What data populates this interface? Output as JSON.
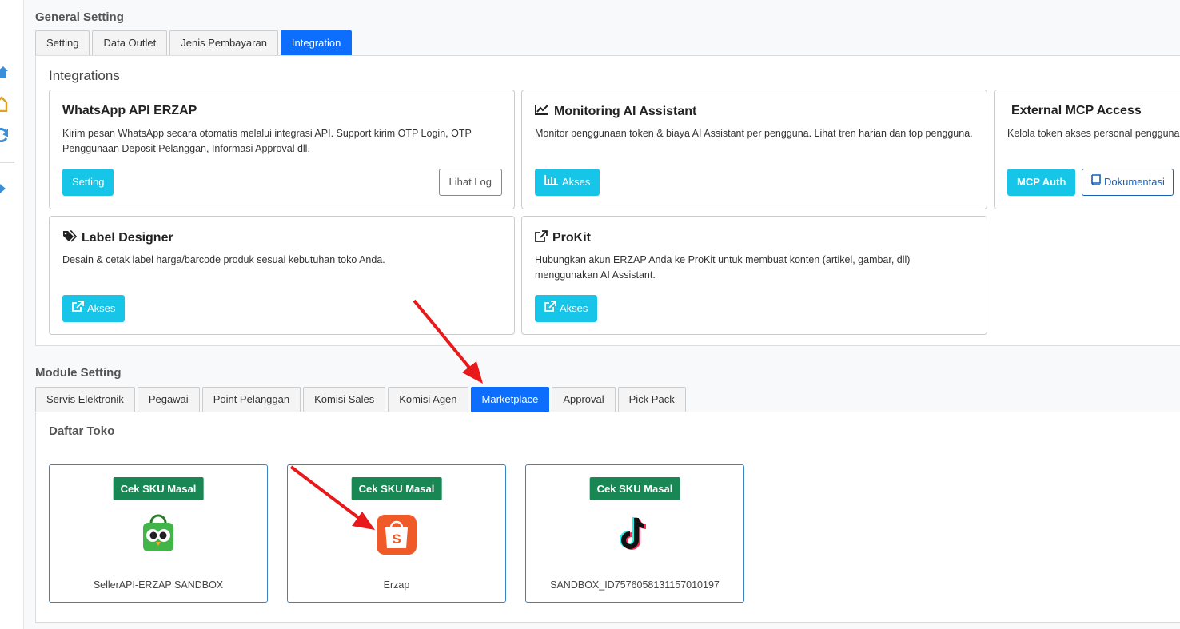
{
  "general": {
    "title": "General Setting",
    "tabs": [
      {
        "label": "Setting",
        "active": false
      },
      {
        "label": "Data Outlet",
        "active": false
      },
      {
        "label": "Jenis Pembayaran",
        "active": false
      },
      {
        "label": "Integration",
        "active": true
      }
    ]
  },
  "integrations": {
    "heading": "Integrations",
    "cards": [
      {
        "title": "WhatsApp API ERZAP",
        "desc": "Kirim pesan WhatsApp secara otomatis melalui integrasi API. Support kirim OTP Login, OTP Penggunaan Deposit Pelanggan, Informasi Approval dll.",
        "button1": "Setting",
        "button2": "Lihat Log"
      },
      {
        "title": "Monitoring AI Assistant",
        "icon": "line-chart-icon",
        "desc": "Monitor penggunaan token & biaya AI Assistant per pengguna. Lihat tren harian dan top pengguna.",
        "button1": "Akses"
      },
      {
        "title": "External MCP Access",
        "desc": "Kelola token akses personal pengguna",
        "button1": "MCP Auth",
        "button2": "Dokumentasi"
      },
      {
        "title": "Label Designer",
        "icon": "tags-icon",
        "desc": "Desain & cetak label harga/barcode produk sesuai kebutuhan toko Anda.",
        "button1": "Akses"
      },
      {
        "title": "ProKit",
        "icon": "external-link-icon",
        "desc": "Hubungkan akun ERZAP Anda ke ProKit untuk membuat konten (artikel, gambar, dll) menggunakan AI Assistant.",
        "button1": "Akses"
      }
    ]
  },
  "module": {
    "title": "Module Setting",
    "tabs": [
      {
        "label": "Servis Elektronik",
        "active": false
      },
      {
        "label": "Pegawai",
        "active": false
      },
      {
        "label": "Point Pelanggan",
        "active": false
      },
      {
        "label": "Komisi Sales",
        "active": false
      },
      {
        "label": "Komisi Agen",
        "active": false
      },
      {
        "label": "Marketplace",
        "active": true
      },
      {
        "label": "Approval",
        "active": false
      },
      {
        "label": "Pick Pack",
        "active": false
      }
    ]
  },
  "marketplace": {
    "heading": "Daftar Toko",
    "shops": [
      {
        "button": "Cek SKU Masal",
        "logo": "tokopedia-logo",
        "name": "SellerAPI-ERZAP SANDBOX"
      },
      {
        "button": "Cek SKU Masal",
        "logo": "shopee-logo",
        "name": "Erzap"
      },
      {
        "button": "Cek SKU Masal",
        "logo": "tiktok-logo",
        "name": "SANDBOX_ID7576058131157010197"
      }
    ]
  },
  "colors": {
    "primary": "#0d6efd",
    "cyan": "#17c5e8",
    "green": "#198754",
    "arrow": "#e8191a"
  }
}
